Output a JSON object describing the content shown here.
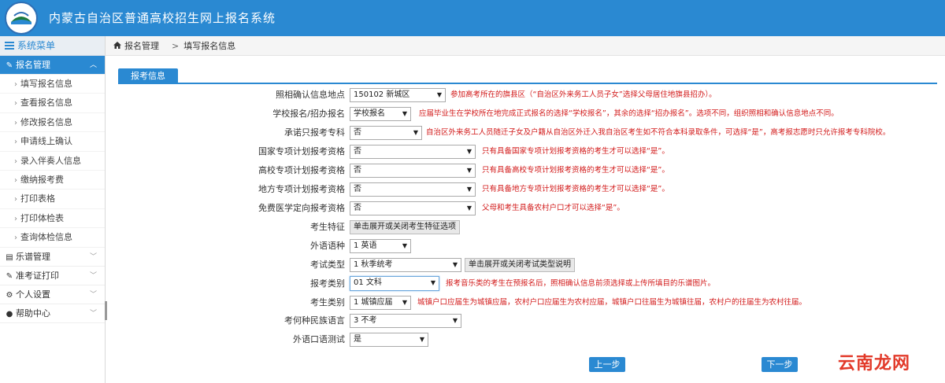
{
  "header": {
    "title": "内蒙古自治区普通高校招生网上报名系统"
  },
  "sidebar": {
    "heading": "系统菜单",
    "groups": [
      {
        "label": "报名管理",
        "icon": "edit-icon",
        "expanded": true
      },
      {
        "label": "乐谱管理",
        "icon": "music-book-icon"
      },
      {
        "label": "准考证打印",
        "icon": "edit-icon"
      },
      {
        "label": "个人设置",
        "icon": "gear-icon"
      },
      {
        "label": "帮助中心",
        "icon": "info-circle-icon"
      }
    ],
    "items": [
      "填写报名信息",
      "查看报名信息",
      "修改报名信息",
      "申请线上确认",
      "录入伴奏人信息",
      "缴纳报考费",
      "打印表格",
      "打印体检表",
      "查询体检信息"
    ]
  },
  "breadcrumb": {
    "root": "报名管理",
    "current": "填写报名信息"
  },
  "tab": {
    "label": "报考信息"
  },
  "form": {
    "rows": [
      {
        "label": "照相确认信息地点",
        "value": "150102 新城区",
        "hint": "参加高考所在的旗县区（“自治区外来务工人员子女”选择父母居住地旗县招办）。"
      },
      {
        "label": "学校报名/招办报名",
        "value": "学校报名",
        "hint": "应届毕业生在学校所在地完成正式报名的选择“学校报名”，其余的选择“招办报名”。选项不同，组织照相和确认信息地点不同。"
      },
      {
        "label": "承诺只报考专科",
        "value": "否",
        "hint": "自治区外来务工人员随迁子女及户籍从自治区外迁入我自治区考生如不符合本科录取条件，可选择“是”，高考报志愿时只允许报考专科院校。"
      },
      {
        "label": "国家专项计划报考资格",
        "value": "否",
        "hint": "只有具备国家专项计划报考资格的考生才可以选择“是”。"
      },
      {
        "label": "高校专项计划报考资格",
        "value": "否",
        "hint": "只有具备高校专项计划报考资格的考生才可以选择“是”。"
      },
      {
        "label": "地方专项计划报考资格",
        "value": "否",
        "hint": "只有具备地方专项计划报考资格的考生才可以选择“是”。"
      },
      {
        "label": "免费医学定向报考资格",
        "value": "否",
        "hint": "父母和考生具备农村户口才可以选择“是”。"
      }
    ],
    "feature": {
      "label": "考生特征",
      "button": "单击展开或关闭考生特征选项"
    },
    "language": {
      "label": "外语语种",
      "value": "1 英语"
    },
    "exam_type": {
      "label": "考试类型",
      "value": "1 秋季统考",
      "button": "单击展开或关闭考试类型说明"
    },
    "category": {
      "label": "报考类别",
      "value": "01 文科",
      "hint": "报考音乐类的考生在预报名后，照相确认信息前须选择或上传所填目的乐谱图片。"
    },
    "student_type": {
      "label": "考生类别",
      "value": "1 城镇应届",
      "hint": "城镇户口应届生为城镇应届，农村户口应届生为农村应届，城镇户口往届生为城镇往届，农村户的往届生为农村往届。"
    },
    "ethnic_lang": {
      "label": "考何种民族语言",
      "value": "3 不考"
    },
    "oral_test": {
      "label": "外语口语测试",
      "value": "是"
    }
  },
  "buttons": {
    "prev": "上一步",
    "next": "下一步"
  },
  "watermark": "云南龙网"
}
